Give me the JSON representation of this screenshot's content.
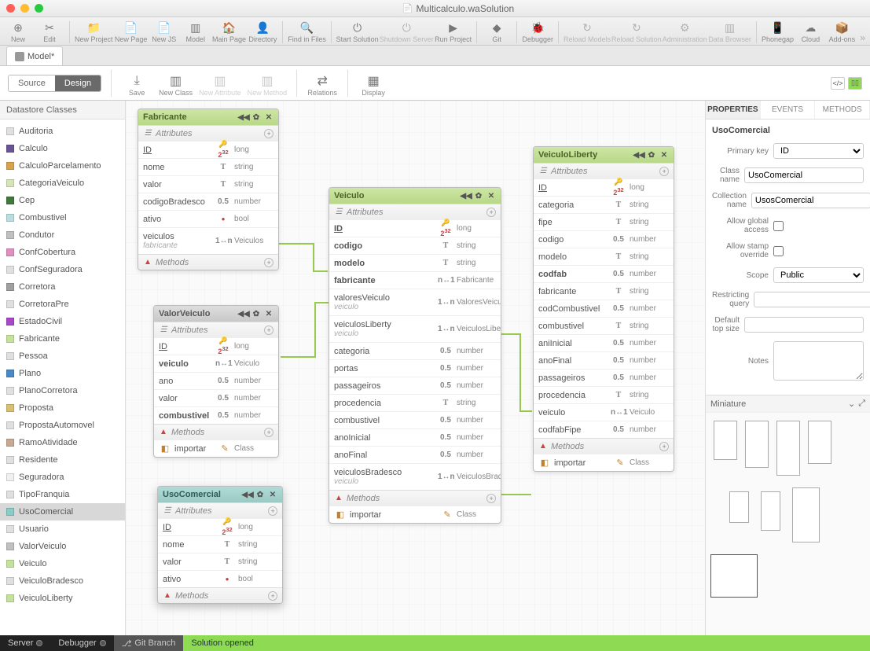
{
  "window": {
    "title": "Multicalculo.waSolution"
  },
  "mainToolbar": [
    {
      "label": "New",
      "icon": "⊕"
    },
    {
      "label": "Edit",
      "icon": "✂"
    },
    {
      "sep": true
    },
    {
      "label": "New Project",
      "icon": "📁"
    },
    {
      "label": "New Page",
      "icon": "📄"
    },
    {
      "label": "New JS",
      "icon": "📄"
    },
    {
      "label": "Model",
      "icon": "▥"
    },
    {
      "label": "Main Page",
      "icon": "🏠"
    },
    {
      "label": "Directory",
      "icon": "👤"
    },
    {
      "sep": true
    },
    {
      "label": "Find in Files",
      "icon": "🔍"
    },
    {
      "sep": true
    },
    {
      "label": "Start Solution",
      "icon": "⏻"
    },
    {
      "label": "Shutdown Server",
      "icon": "⏻",
      "disabled": true
    },
    {
      "label": "Run Project",
      "icon": "▶"
    },
    {
      "sep": true
    },
    {
      "label": "Git",
      "icon": "◆"
    },
    {
      "sep": true
    },
    {
      "label": "Debugger",
      "icon": "🐞"
    },
    {
      "sep": true
    },
    {
      "label": "Reload Models",
      "icon": "↻",
      "disabled": true
    },
    {
      "label": "Reload Solution",
      "icon": "↻",
      "disabled": true
    },
    {
      "label": "Administration",
      "icon": "⚙",
      "disabled": true
    },
    {
      "label": "Data Browser",
      "icon": "▥",
      "disabled": true
    },
    {
      "sep": true
    },
    {
      "label": "Phonegap",
      "icon": "📱"
    },
    {
      "label": "Cloud",
      "icon": "☁"
    },
    {
      "label": "Add-ons",
      "icon": "📦"
    }
  ],
  "tab": {
    "label": "Model*"
  },
  "segControl": {
    "source": "Source",
    "design": "Design"
  },
  "secToolbar": [
    {
      "label": "Save",
      "icon": "⤓"
    },
    {
      "label": "New Class",
      "icon": "▥"
    },
    {
      "label": "New Attribute",
      "icon": "▥",
      "disabled": true
    },
    {
      "label": "New Method",
      "icon": "▥",
      "disabled": true
    },
    {
      "sep": true
    },
    {
      "label": "Relations",
      "icon": "⇄"
    },
    {
      "sep": true
    },
    {
      "label": "Display",
      "icon": "▦"
    }
  ],
  "leftPanel": {
    "header": "Datastore Classes",
    "items": [
      {
        "name": "Auditoria",
        "color": "#e0e0e0"
      },
      {
        "name": "Calculo",
        "color": "#6a5494"
      },
      {
        "name": "CalculoParcelamento",
        "color": "#d9a24a"
      },
      {
        "name": "CategoriaVeiculo",
        "color": "#d6e5b6"
      },
      {
        "name": "Cep",
        "color": "#3f7a3c"
      },
      {
        "name": "Combustivel",
        "color": "#b8dee0"
      },
      {
        "name": "Condutor",
        "color": "#c0c0c0"
      },
      {
        "name": "ConfCobertura",
        "color": "#e090c0"
      },
      {
        "name": "ConfSeguradora",
        "color": "#e0e0e0"
      },
      {
        "name": "Corretora",
        "color": "#a0a0a0"
      },
      {
        "name": "CorretoraPre",
        "color": "#e0e0e0"
      },
      {
        "name": "EstadoCivil",
        "color": "#a848c8"
      },
      {
        "name": "Fabricante",
        "color": "#c5e29a"
      },
      {
        "name": "Pessoa",
        "color": "#e0e0e0"
      },
      {
        "name": "Plano",
        "color": "#4a8ac4"
      },
      {
        "name": "PlanoCorretora",
        "color": "#e0e0e0"
      },
      {
        "name": "Proposta",
        "color": "#d8c070"
      },
      {
        "name": "PropostaAutomovel",
        "color": "#e0e0e0"
      },
      {
        "name": "RamoAtividade",
        "color": "#c8a890"
      },
      {
        "name": "Residente",
        "color": "#e0e0e0"
      },
      {
        "name": "Seguradora",
        "color": "#f0f0f0"
      },
      {
        "name": "TipoFranquia",
        "color": "#e0e0e0"
      },
      {
        "name": "UsoComercial",
        "color": "#8accc6",
        "selected": true
      },
      {
        "name": "Usuario",
        "color": "#e0e0e0"
      },
      {
        "name": "ValorVeiculo",
        "color": "#c0c0c0"
      },
      {
        "name": "Veiculo",
        "color": "#c5e29a"
      },
      {
        "name": "VeiculoBradesco",
        "color": "#e0e0e0"
      },
      {
        "name": "VeiculoLiberty",
        "color": "#c5e29a"
      }
    ]
  },
  "entities": {
    "fabricante": {
      "title": "Fabricante",
      "sections": {
        "attributes": "Attributes",
        "methods": "Methods"
      },
      "attrs": [
        {
          "n": "ID",
          "i": "key232",
          "t": "long",
          "u": true
        },
        {
          "n": "nome",
          "i": "T",
          "t": "string"
        },
        {
          "n": "valor",
          "i": "T",
          "t": "string"
        },
        {
          "n": "codigoBradesco",
          "i": "0.5",
          "t": "number"
        },
        {
          "n": "ativo",
          "i": "bool",
          "t": "bool"
        },
        {
          "n": "veiculos",
          "i": "1↔n",
          "t": "Veiculos",
          "sub": "fabricante"
        }
      ]
    },
    "valorVeiculo": {
      "title": "ValorVeiculo",
      "sections": {
        "attributes": "Attributes",
        "methods": "Methods"
      },
      "attrs": [
        {
          "n": "ID",
          "i": "key232",
          "t": "long",
          "u": true
        },
        {
          "n": "veiculo",
          "i": "n↔1",
          "t": "Veiculo",
          "b": true
        },
        {
          "n": "ano",
          "i": "0.5",
          "t": "number"
        },
        {
          "n": "valor",
          "i": "0.5",
          "t": "number"
        },
        {
          "n": "combustivel",
          "i": "0.5",
          "t": "number",
          "b": true
        }
      ],
      "methods": [
        {
          "n": "importar",
          "t": "Class"
        }
      ]
    },
    "usoComercial": {
      "title": "UsoComercial",
      "sections": {
        "attributes": "Attributes",
        "methods": "Methods"
      },
      "attrs": [
        {
          "n": "ID",
          "i": "key232",
          "t": "long",
          "u": true
        },
        {
          "n": "nome",
          "i": "T",
          "t": "string"
        },
        {
          "n": "valor",
          "i": "T",
          "t": "string"
        },
        {
          "n": "ativo",
          "i": "bool",
          "t": "bool"
        }
      ]
    },
    "veiculo": {
      "title": "Veiculo",
      "sections": {
        "attributes": "Attributes",
        "methods": "Methods"
      },
      "attrs": [
        {
          "n": "ID",
          "i": "key232",
          "t": "long",
          "u": true,
          "b": true
        },
        {
          "n": "codigo",
          "i": "T",
          "t": "string",
          "b": true
        },
        {
          "n": "modelo",
          "i": "T",
          "t": "string",
          "b": true
        },
        {
          "n": "fabricante",
          "i": "n↔1",
          "t": "Fabricante",
          "b": true
        },
        {
          "n": "valoresVeiculo",
          "i": "1↔n",
          "t": "ValoresVeiculo",
          "sub": "veiculo"
        },
        {
          "n": "veiculosLiberty",
          "i": "1↔n",
          "t": "VeiculosLiberty",
          "sub": "veiculo"
        },
        {
          "n": "categoria",
          "i": "0.5",
          "t": "number"
        },
        {
          "n": "portas",
          "i": "0.5",
          "t": "number"
        },
        {
          "n": "passageiros",
          "i": "0.5",
          "t": "number"
        },
        {
          "n": "procedencia",
          "i": "T",
          "t": "string"
        },
        {
          "n": "combustivel",
          "i": "0.5",
          "t": "number"
        },
        {
          "n": "anoInicial",
          "i": "0.5",
          "t": "number"
        },
        {
          "n": "anoFinal",
          "i": "0.5",
          "t": "number"
        },
        {
          "n": "veiculosBradesco",
          "i": "1↔n",
          "t": "VeiculosBradesco",
          "sub": "veiculo"
        }
      ],
      "methods": [
        {
          "n": "importar",
          "t": "Class"
        }
      ]
    },
    "veiculoLiberty": {
      "title": "VeiculoLiberty",
      "sections": {
        "attributes": "Attributes",
        "methods": "Methods"
      },
      "attrs": [
        {
          "n": "ID",
          "i": "key232",
          "t": "long",
          "u": true
        },
        {
          "n": "categoria",
          "i": "T",
          "t": "string"
        },
        {
          "n": "fipe",
          "i": "T",
          "t": "string"
        },
        {
          "n": "codigo",
          "i": "0.5",
          "t": "number"
        },
        {
          "n": "modelo",
          "i": "T",
          "t": "string"
        },
        {
          "n": "codfab",
          "i": "0.5",
          "t": "number",
          "b": true
        },
        {
          "n": "fabricante",
          "i": "T",
          "t": "string"
        },
        {
          "n": "codCombustivel",
          "i": "0.5",
          "t": "number"
        },
        {
          "n": "combustivel",
          "i": "T",
          "t": "string"
        },
        {
          "n": "aniInicial",
          "i": "0.5",
          "t": "number"
        },
        {
          "n": "anoFinal",
          "i": "0.5",
          "t": "number"
        },
        {
          "n": "passageiros",
          "i": "0.5",
          "t": "number"
        },
        {
          "n": "procedencia",
          "i": "T",
          "t": "string"
        },
        {
          "n": "veiculo",
          "i": "n↔1",
          "t": "Veiculo"
        },
        {
          "n": "codfabFipe",
          "i": "0.5",
          "t": "number"
        }
      ],
      "methods": [
        {
          "n": "importar",
          "t": "Class"
        }
      ]
    }
  },
  "rightPanel": {
    "tabs": [
      "PROPERTIES",
      "EVENTS",
      "METHODS"
    ],
    "title": "UsoComercial",
    "fields": {
      "primaryKey": {
        "label": "Primary key",
        "value": "ID"
      },
      "className": {
        "label": "Class name",
        "value": "UsoComercial"
      },
      "collectionName": {
        "label": "Collection name",
        "value": "UsosComercial"
      },
      "allowGlobal": {
        "label": "Allow global access",
        "checked": false
      },
      "allowStamp": {
        "label": "Allow stamp override",
        "checked": false
      },
      "scope": {
        "label": "Scope",
        "value": "Public"
      },
      "restricting": {
        "label": "Restricting query",
        "value": ""
      },
      "topSize": {
        "label": "Default top size",
        "value": ""
      },
      "notes": {
        "label": "Notes",
        "value": ""
      }
    },
    "miniature": "Miniature"
  },
  "statusbar": {
    "server": "Server",
    "debugger": "Debugger",
    "git": "Git Branch",
    "solution": "Solution opened"
  }
}
